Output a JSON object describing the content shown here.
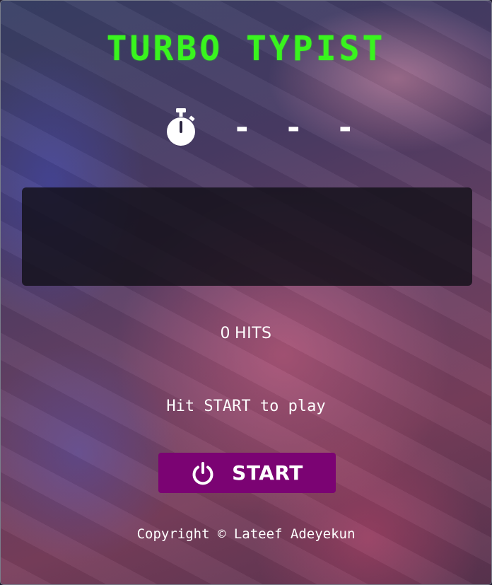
{
  "game": {
    "title": "TURBO TYPIST",
    "timer_icon": "stopwatch-icon",
    "timer_value": "- - -",
    "text_display": "",
    "hits_count": "0",
    "hits_label": "HITS",
    "prompt": "Hit START to play",
    "start_button": {
      "icon": "power-icon",
      "label": "START"
    },
    "copyright": "Copyright © Lateef Adeyekun"
  },
  "colors": {
    "title": "#39f51e",
    "button_bg": "#7b0373",
    "text": "#ffffff",
    "panel_bg": "#121018"
  }
}
